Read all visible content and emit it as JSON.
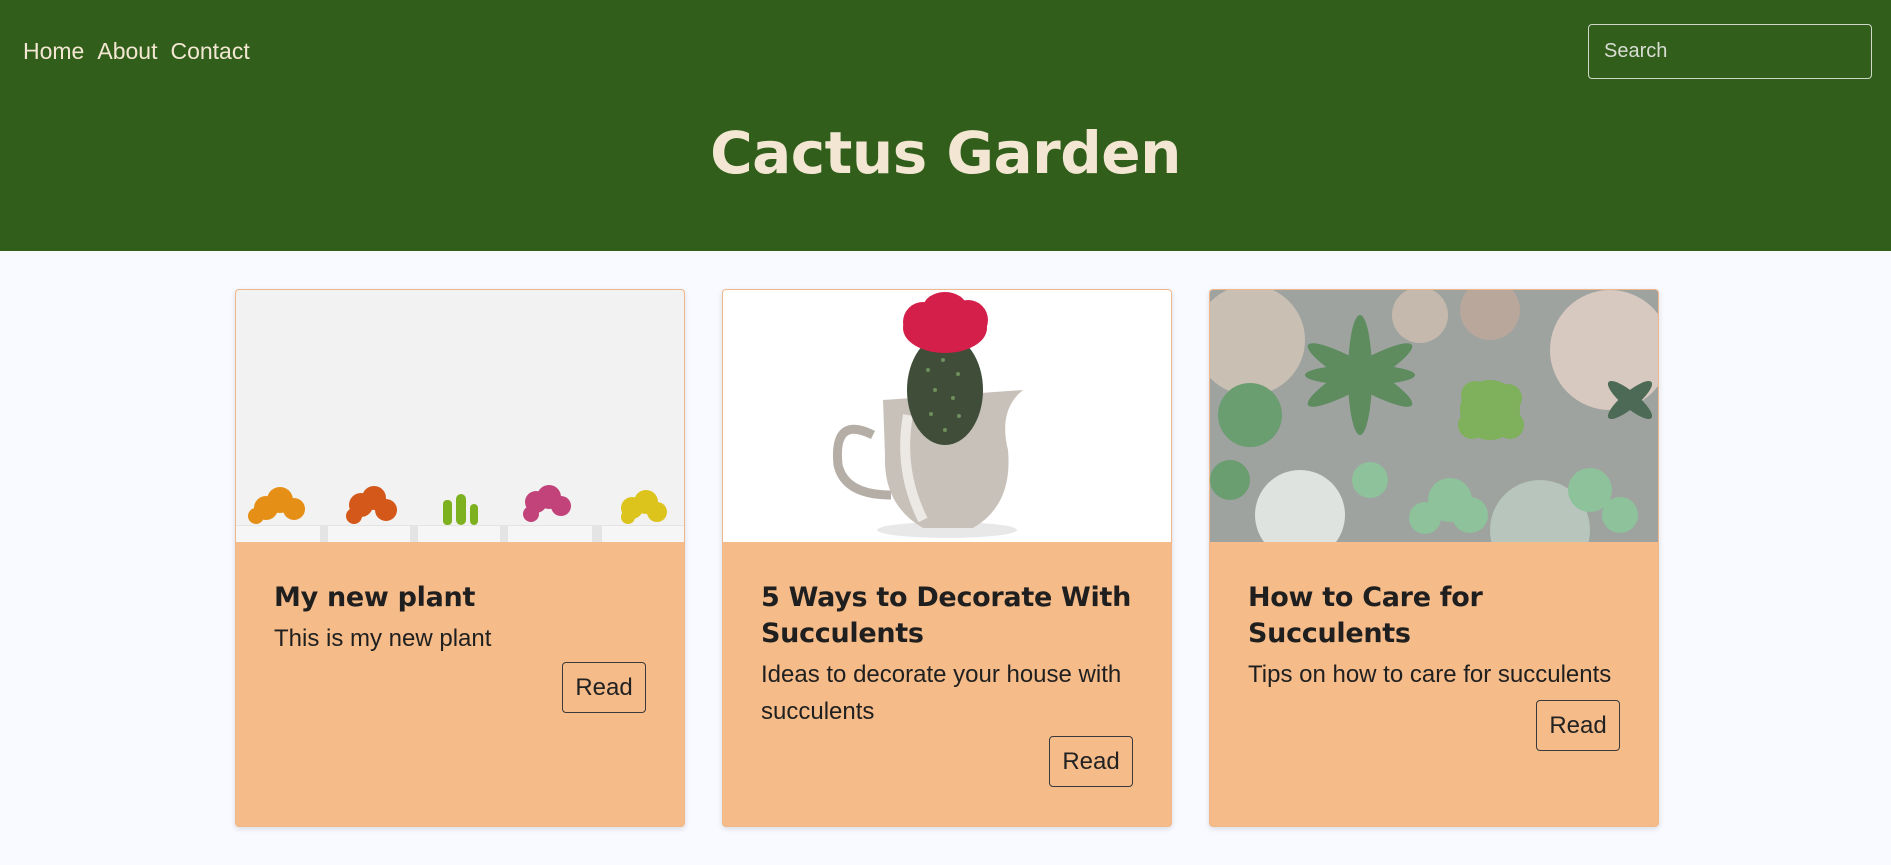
{
  "nav": {
    "items": [
      {
        "label": "Home"
      },
      {
        "label": "About"
      },
      {
        "label": "Contact"
      }
    ]
  },
  "search": {
    "placeholder": "Search",
    "value": ""
  },
  "header": {
    "title": "Cactus Garden"
  },
  "cards": [
    {
      "title": "My new plant",
      "text": "This is my new plant",
      "button": "Read",
      "image_icon": "potted-cacti-row-image"
    },
    {
      "title": "5 Ways to Decorate With Succulents",
      "text": "Ideas to decorate your house with succulents",
      "button": "Read",
      "image_icon": "cactus-in-silver-jug-image"
    },
    {
      "title": "How to Care for Succulents",
      "text": "Tips on how to care for succulents",
      "button": "Read",
      "image_icon": "succulent-pots-overhead-image"
    }
  ],
  "colors": {
    "header_bg": "#315e1a",
    "header_text": "#f3e7d3",
    "card_bg": "#f5bb89",
    "page_bg": "#f8faff"
  }
}
